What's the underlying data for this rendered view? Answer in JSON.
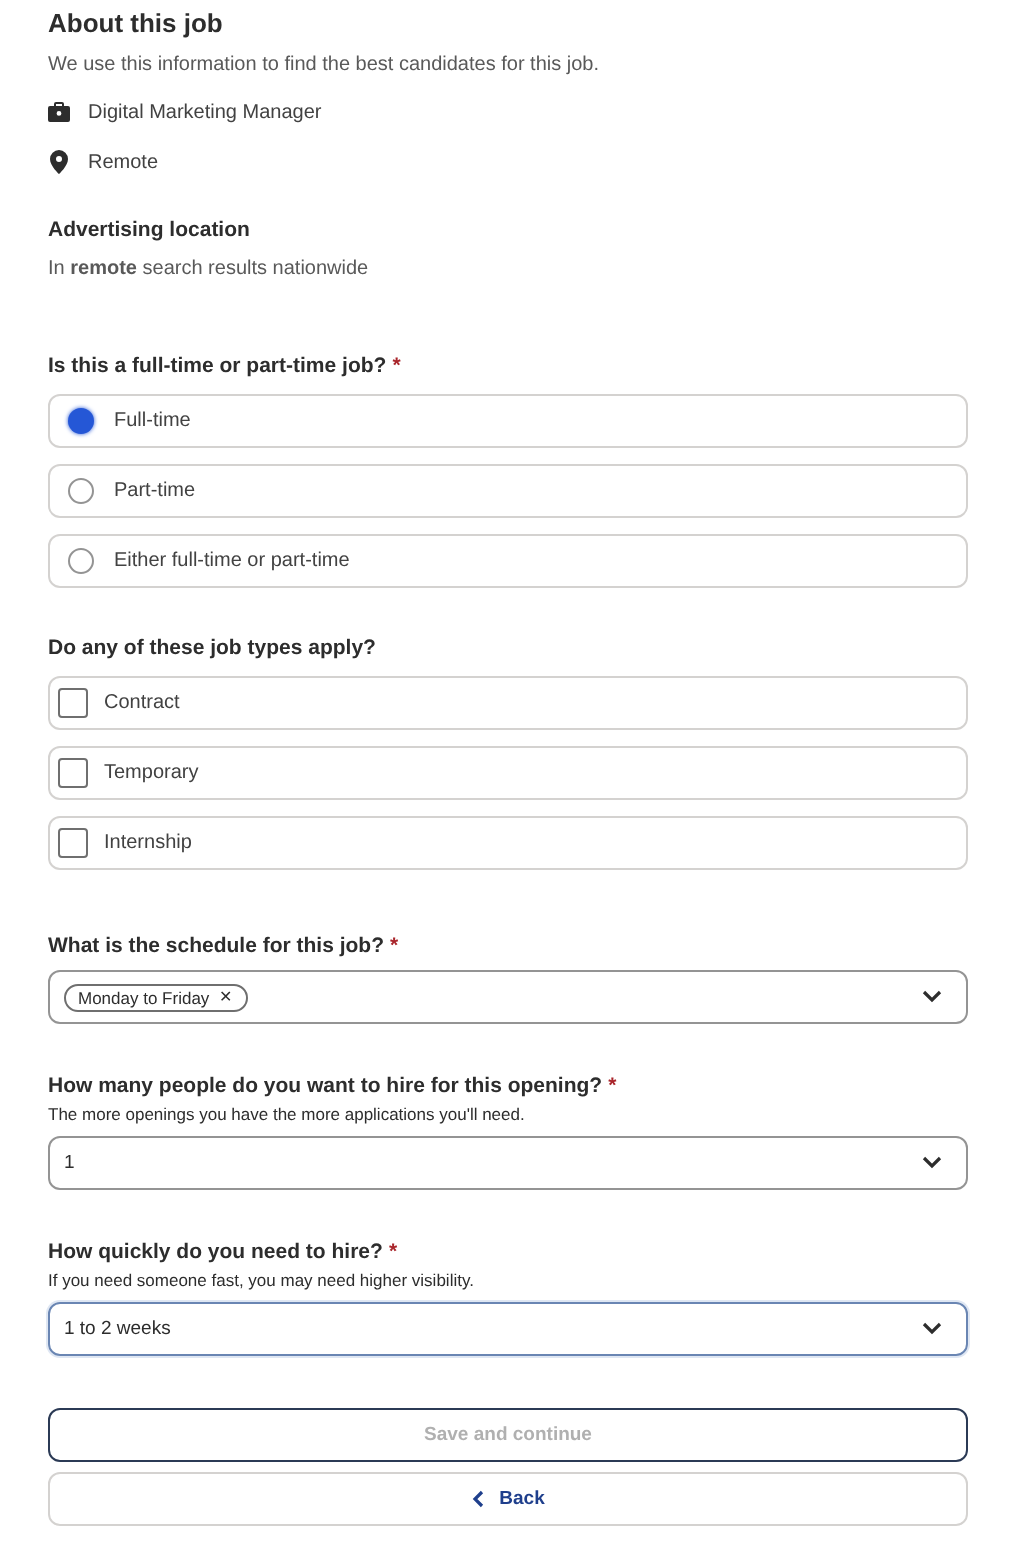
{
  "about": {
    "title": "About this job",
    "subtitle": "We use this information to find the best candidates for this job.",
    "details": [
      {
        "kind": "job",
        "text": "Digital Marketing Manager"
      },
      {
        "kind": "location",
        "text": "Remote"
      }
    ],
    "advertising": {
      "title": "Advertising location",
      "text": "In **remote** search results nationwide"
    }
  },
  "job_type": {
    "question": "Is this a full-time or part-time job?",
    "required_mark": "*",
    "options": [
      {
        "label": "Full-time",
        "selected": true
      },
      {
        "label": "Part-time",
        "selected": false
      },
      {
        "label": "Either full-time or part-time",
        "selected": false
      }
    ]
  },
  "job_types_apply": {
    "question": "Do any of these job types apply?",
    "options": [
      {
        "label": "Contract",
        "checked": false
      },
      {
        "label": "Temporary",
        "checked": false
      },
      {
        "label": "Internship",
        "checked": false
      }
    ]
  },
  "selects": [
    {
      "question": "What is the schedule for this job?",
      "required_mark": "*",
      "chips": [
        "Monday to Friday"
      ],
      "chip_remove": "✕",
      "focused": false
    },
    {
      "question": "How many people do you want to hire for this opening?",
      "required_mark": "*",
      "hint": "The more openings you have the more applications you'll need.",
      "value": "1",
      "focused": false
    },
    {
      "question": "How quickly do you need to hire?",
      "required_mark": "*",
      "hint": "If you need someone fast, you may need higher visibility.",
      "value": "1 to 2 weeks",
      "focused": true
    }
  ],
  "buttons": [
    {
      "kind": "primary",
      "label": "Save and continue",
      "disabled": true,
      "focused": true
    },
    {
      "kind": "back",
      "label": "Back",
      "disabled": false,
      "focused": false
    }
  ]
}
